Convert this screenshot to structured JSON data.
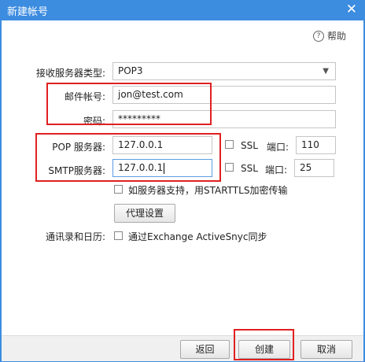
{
  "window": {
    "title": "新建帐号",
    "close_glyph": "✕"
  },
  "help": {
    "label": "帮助",
    "icon": "?"
  },
  "form": {
    "receive_type_label": "接收服务器类型:",
    "receive_type_value": "POP3",
    "email_label": "邮件帐号:",
    "email_value": "jon@test.com",
    "password_label": "密码:",
    "password_value": "*********",
    "pop_label": "POP 服务器:",
    "pop_value": "127.0.0.1",
    "pop_ssl_label": "SSL",
    "pop_port_label": "端口:",
    "pop_port_value": "110",
    "smtp_label": "SMTP服务器:",
    "smtp_value": "127.0.0.1",
    "smtp_ssl_label": "SSL",
    "smtp_port_label": "端口:",
    "smtp_port_value": "25",
    "starttls_label": "如服务器支持，用STARTTLS加密传输",
    "proxy_button": "代理设置",
    "sync_label": "通讯录和日历:",
    "sync_option": "通过Exchange ActiveSnyc同步"
  },
  "footer": {
    "back": "返回",
    "create": "创建",
    "cancel": "取消"
  },
  "colors": {
    "titlebar": "#3c8ce0",
    "highlight": "#e02020"
  },
  "icons": {
    "dropdown": "chevron-down-icon",
    "close": "close-icon",
    "help": "help-icon"
  }
}
